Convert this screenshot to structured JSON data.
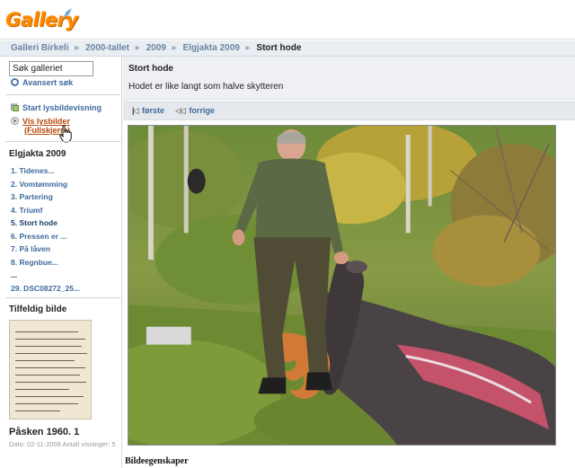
{
  "header": {
    "logo_text": "Gallery"
  },
  "breadcrumb": {
    "items": [
      "Galleri Birkeli",
      "2000-tallet",
      "2009",
      "Elgjakta 2009"
    ],
    "current": "Stort hode",
    "separator": "▸"
  },
  "sidebar": {
    "search_value": "Søk galleriet",
    "advanced_search": "Avansert søk",
    "slideshow": "Start lysbildevisning",
    "view_slides_line1": "Vis lysbilder",
    "view_slides_line2": "(Fullskjerm)",
    "album_title": "Elgjakta 2009",
    "album_items": [
      "1. Tidenes...",
      "2. Vomtømming",
      "3. Partering",
      "4. Triumf",
      "5. Stort hode",
      "6. Pressen er ...",
      "7. På låven",
      "8. Regnbue...",
      "...",
      "29. DSC08272_25..."
    ],
    "random_title": "Tilfeldig bilde",
    "random_caption": "Påsken 1960. 1",
    "random_meta": "Dato: 02-11-2009 Antall visninger: 5"
  },
  "main": {
    "title": "Stort hode",
    "description": "Hodet er like langt som halve skytteren",
    "nav_first": "første",
    "nav_prev": "forrige",
    "properties_title": "Bildeegenskaper"
  },
  "colors": {
    "accent_link": "#3d6a9c",
    "logo_orange": "#ff8a00",
    "highlight_link": "#b5480a"
  }
}
